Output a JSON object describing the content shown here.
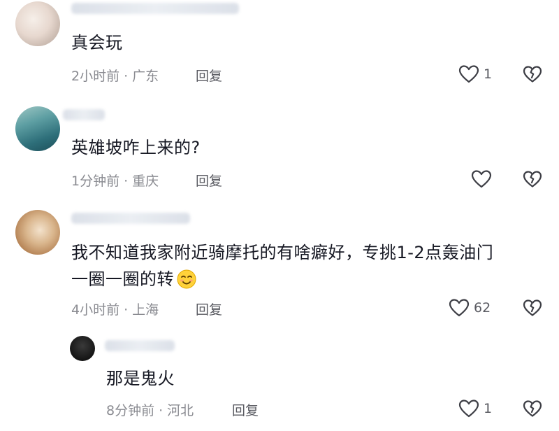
{
  "comments": [
    {
      "content": "真会玩",
      "time": "2小时前",
      "location": "广东",
      "reply_label": "回复",
      "likes": "1"
    },
    {
      "content": "英雄坡咋上来的?",
      "time": "1分钟前",
      "location": "重庆",
      "reply_label": "回复",
      "likes": ""
    },
    {
      "content_line1": "我不知道我家附近骑摩托的有啥癖好，专挑1-2点轰油门",
      "content_line2": "一圈一圈的转",
      "time": "4小时前",
      "location": "上海",
      "reply_label": "回复",
      "likes": "62"
    }
  ],
  "reply": {
    "content": "那是鬼火",
    "time": "8分钟前",
    "location": "河北",
    "reply_label": "回复",
    "likes": "1"
  },
  "icons": {
    "like": "heart-outline-icon",
    "dislike": "broken-heart-icon",
    "emoji": "smiling-face-emoji"
  },
  "colors": {
    "text": "#161823",
    "meta": "#8a8b91",
    "icon": "#3d3e45"
  }
}
